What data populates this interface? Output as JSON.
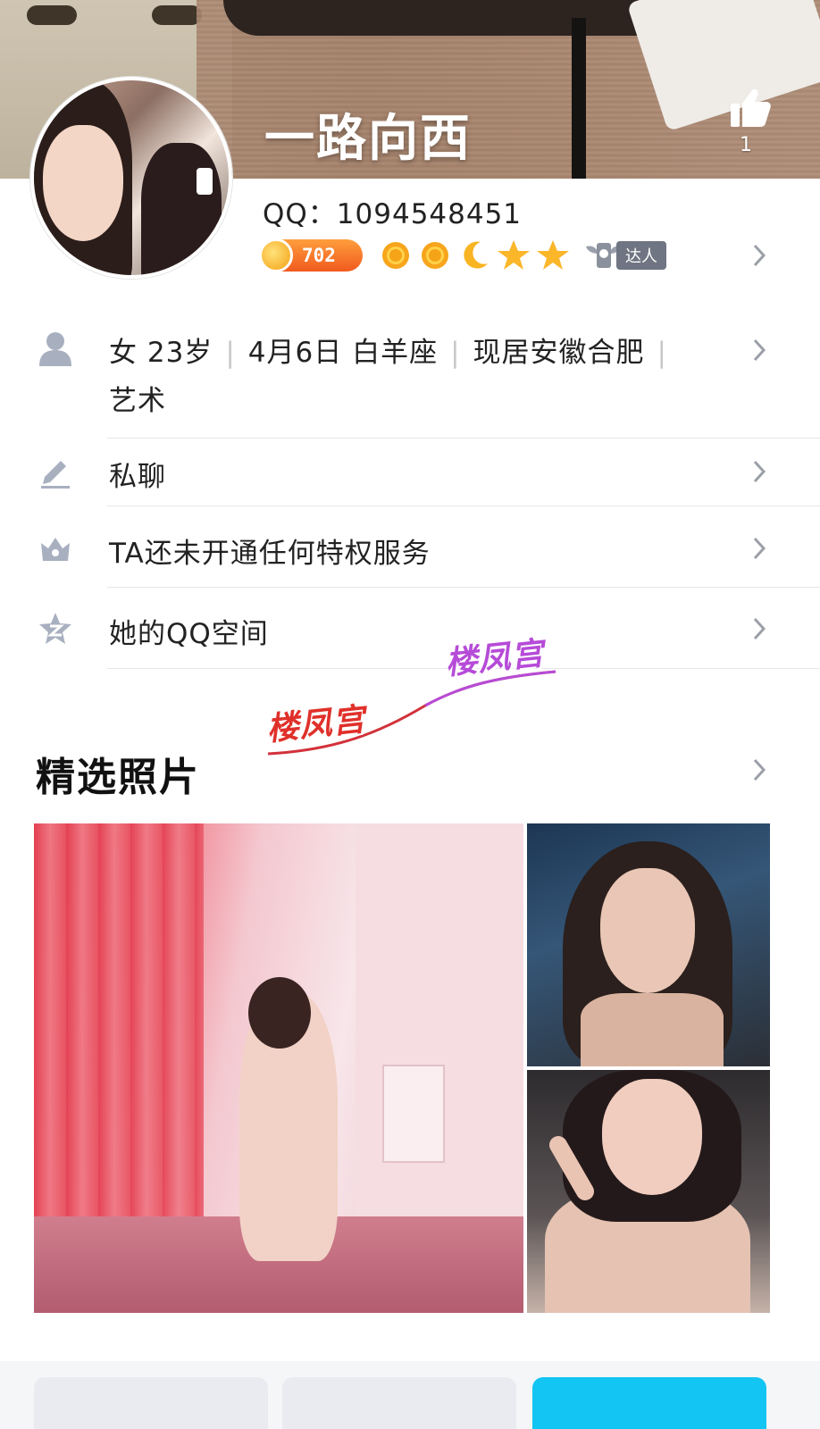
{
  "header": {
    "nickname": "一路向西",
    "like_count": "1"
  },
  "profile": {
    "qq_label": "QQ：1094548451",
    "level_number": "702",
    "level_icons": [
      "sun-icon",
      "sun-icon",
      "moon-icon",
      "star-icon",
      "star-icon"
    ],
    "daren_label": "达人"
  },
  "info": {
    "gender_age": "女 23岁",
    "birthday": "4月6日 白羊座",
    "location": "现居安徽合肥",
    "occupation": "艺术"
  },
  "rows": [
    {
      "label": "私聊",
      "icon": "pencil-icon"
    },
    {
      "label": "TA还未开通任何特权服务",
      "icon": "crown-icon"
    },
    {
      "label": "她的QQ空间",
      "icon": "qzone-star-icon"
    }
  ],
  "watermark": {
    "text_a": "楼凤宫",
    "text_b": "楼凤宫"
  },
  "photos": {
    "section_title": "精选照片"
  },
  "colors": {
    "accent": "#13c5f2",
    "level_orange": "#f05a1e",
    "icon_gray": "#6f7582"
  }
}
